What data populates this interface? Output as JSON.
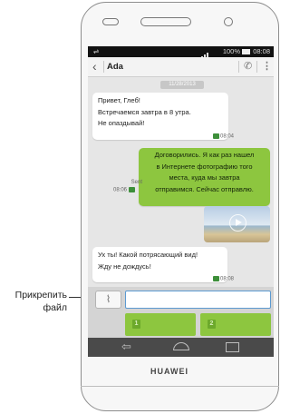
{
  "callout": {
    "label_line1": "Прикрепить",
    "label_line2": "файл"
  },
  "device": {
    "brand": "HUAWEI"
  },
  "statusbar": {
    "battery": "100%",
    "time": "08:08"
  },
  "header": {
    "contact": "Ada",
    "back_icon": "chevron-left-icon",
    "call_icon": "phone-icon",
    "menu_icon": "kebab-menu-icon"
  },
  "conversation": {
    "date": "11/28/2013",
    "messages": [
      {
        "direction": "incoming",
        "lines": [
          "Привет, Глеб!",
          "Встречаемся завтра в 8 утра.",
          "Не опаздывай!"
        ],
        "time": "08:04"
      },
      {
        "direction": "outgoing",
        "lines": [
          "Договорились. Я как раз нашел",
          "в Интернете фотографию того",
          "места, куда мы завтра",
          "отправимся. Сейчас отправлю."
        ],
        "status": "Sent",
        "time": "08:06"
      },
      {
        "direction": "outgoing",
        "type": "image",
        "icon": "play-icon"
      },
      {
        "direction": "incoming",
        "lines": [
          "Ух ты! Какой потрясающий вид!",
          "Жду не дождусь!"
        ],
        "time": "08:08"
      }
    ]
  },
  "composer": {
    "attach_icon": "paperclip-icon",
    "placeholder": "",
    "send1": "1",
    "send2": "2"
  },
  "navbar": {
    "back_icon": "back-arrow-icon",
    "home_icon": "home-icon",
    "recent_icon": "recent-apps-icon"
  },
  "colors": {
    "accent_green": "#8dc63f",
    "input_border": "#5c9ad1",
    "navbar": "#4a4a4a"
  }
}
